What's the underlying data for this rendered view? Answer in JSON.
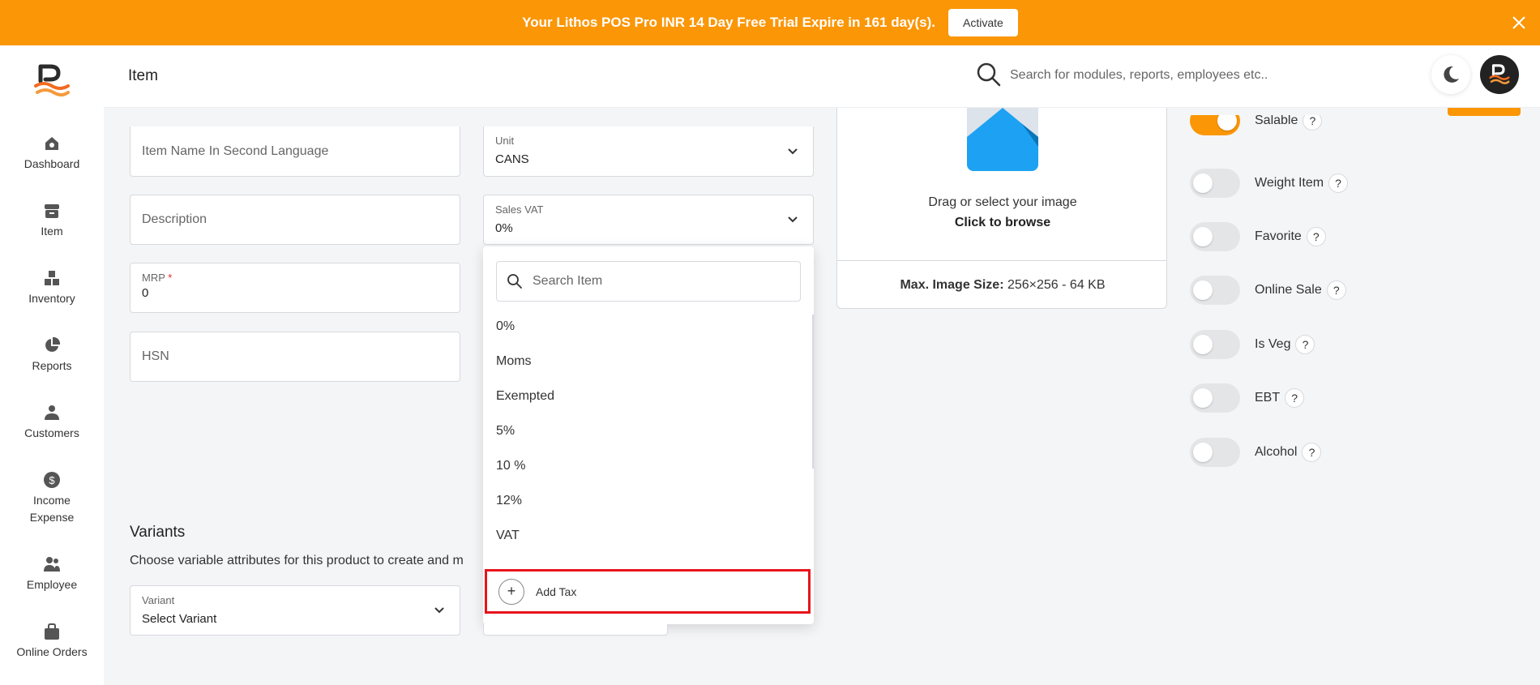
{
  "banner": {
    "text": "Your Lithos POS Pro INR 14 Day Free Trial Expire in 161 day(s).",
    "activate_label": "Activate"
  },
  "sidebar": {
    "items": [
      {
        "label": "Dashboard",
        "icon": "dashboard-icon"
      },
      {
        "label": "Item",
        "icon": "item-icon"
      },
      {
        "label": "Inventory",
        "icon": "inventory-icon"
      },
      {
        "label": "Reports",
        "icon": "reports-icon"
      },
      {
        "label": "Customers",
        "icon": "customers-icon"
      },
      {
        "label": "Income",
        "label2": "Expense",
        "icon": "income-expense-icon"
      },
      {
        "label": "Employee",
        "icon": "employee-icon"
      },
      {
        "label": "Online Orders",
        "icon": "online-orders-icon"
      }
    ]
  },
  "header": {
    "title": "Item",
    "search_placeholder": "Search for modules, reports, employees etc.."
  },
  "form": {
    "second_language_placeholder": "Item Name In Second Language",
    "description_placeholder": "Description",
    "mrp_label": "MRP",
    "mrp_required": "*",
    "mrp_value": "0",
    "hsn_placeholder": "HSN",
    "unit_label": "Unit",
    "unit_value": "CANS",
    "sales_vat_label": "Sales VAT",
    "sales_vat_value": "0%"
  },
  "dropdown": {
    "search_placeholder": "Search Item",
    "options": [
      "0%",
      "Moms",
      "Exempted",
      "5%",
      "10 %",
      "12%",
      "VAT"
    ],
    "add_label": "Add Tax"
  },
  "image_upload": {
    "line1": "Drag or select your image",
    "line2": "Click to browse",
    "max_label": "Max. Image Size:",
    "max_value": "256×256 - 64 KB"
  },
  "toggles": [
    {
      "label": "Salable",
      "on": true
    },
    {
      "label": "Weight Item",
      "on": false
    },
    {
      "label": "Favorite",
      "on": false
    },
    {
      "label": "Online Sale",
      "on": false
    },
    {
      "label": "Is Veg",
      "on": false
    },
    {
      "label": "EBT",
      "on": false
    },
    {
      "label": "Alcohol",
      "on": false
    }
  ],
  "help_glyph": "?",
  "variants": {
    "title": "Variants",
    "description": "Choose variable attributes for this product to create and m",
    "field_label": "Variant",
    "field_value": "Select Variant"
  },
  "colors": {
    "brand_orange": "#fb9606",
    "highlight_red": "#e8131b"
  }
}
